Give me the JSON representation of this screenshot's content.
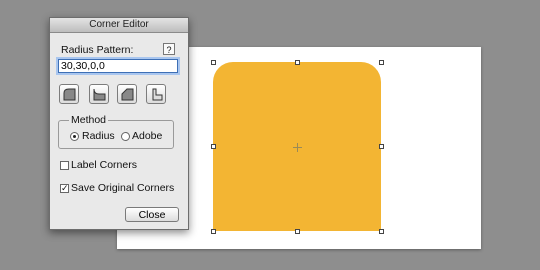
{
  "dialog": {
    "title": "Corner Editor",
    "radius_label": "Radius Pattern:",
    "help_label": "?",
    "radius_value": "30,30,0,0",
    "corner_buttons": [
      "rounded-corner-icon",
      "inverted-round-corner-icon",
      "bevel-corner-icon",
      "inset-corner-icon"
    ],
    "method": {
      "title": "Method",
      "options": [
        {
          "label": "Radius",
          "selected": true
        },
        {
          "label": "Adobe",
          "selected": false
        }
      ]
    },
    "label_corners": {
      "label": "Label Corners",
      "checked": false
    },
    "save_original": {
      "label": "Save Original Corners",
      "checked": true
    },
    "close_label": "Close"
  },
  "canvas": {
    "shape_fill": "#f3b533",
    "background": "#ffffff",
    "workspace": "#8e8e8e"
  }
}
